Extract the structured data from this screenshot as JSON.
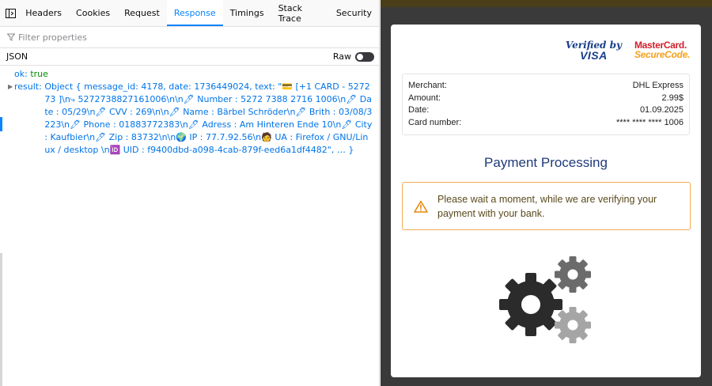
{
  "devtools": {
    "tabs": [
      {
        "label": "Headers"
      },
      {
        "label": "Cookies"
      },
      {
        "label": "Request"
      },
      {
        "label": "Response",
        "active": true
      },
      {
        "label": "Timings"
      },
      {
        "label": "Stack Trace"
      },
      {
        "label": "Security"
      }
    ],
    "filter_placeholder": "Filter properties",
    "section_label": "JSON",
    "raw_label": "Raw",
    "ok_key": "ok:",
    "ok_value": "true",
    "result_key": "result:",
    "result_value": "Object { message_id: 4178, date: 1736449024, text: \"💳 [+1 CARD - 527273 ]\\n⤷ 5272738827161006\\n\\n🖊 Number : 5272 7388 2716 1006\\n🖊 Date : 05/29\\n🖊 CVV : 269\\n\\n🖊 Name : Bärbel Schröder\\n🖊 Brith : 03/08/3223\\n🖊 Phone : 01883772383\\n🖊 Adress : Am Hinteren Ende 10\\n🖊 City : Kaufbier\\n🖊 Zip : 83732\\n\\n🌍 IP : 77.7.92.56\\n🧑 UA : Firefox / GNU/Linux / desktop \\n🆔 UID : f9400dbd-a098-4cab-879f-eed6a1df4482\", … }"
  },
  "payment": {
    "brand_visa_line1": "Verified by",
    "brand_visa_line2": "VISA",
    "brand_mc_line1": "MasterCard.",
    "brand_mc_line2": "SecureCode.",
    "details": [
      {
        "label": "Merchant:",
        "value": "DHL Express"
      },
      {
        "label": "Amount:",
        "value": "2.99$"
      },
      {
        "label": "Date:",
        "value": "01.09.2025"
      },
      {
        "label": "Card number:",
        "value": "**** **** **** 1006"
      }
    ],
    "title": "Payment Processing",
    "alert_text": "Please wait a moment, while we are verifying your payment with your bank.",
    "colors": {
      "title": "#1f3a7a",
      "alert_border": "#f0ad4e",
      "alert_icon": "#e8890c",
      "background": "#3a3a3b"
    }
  }
}
